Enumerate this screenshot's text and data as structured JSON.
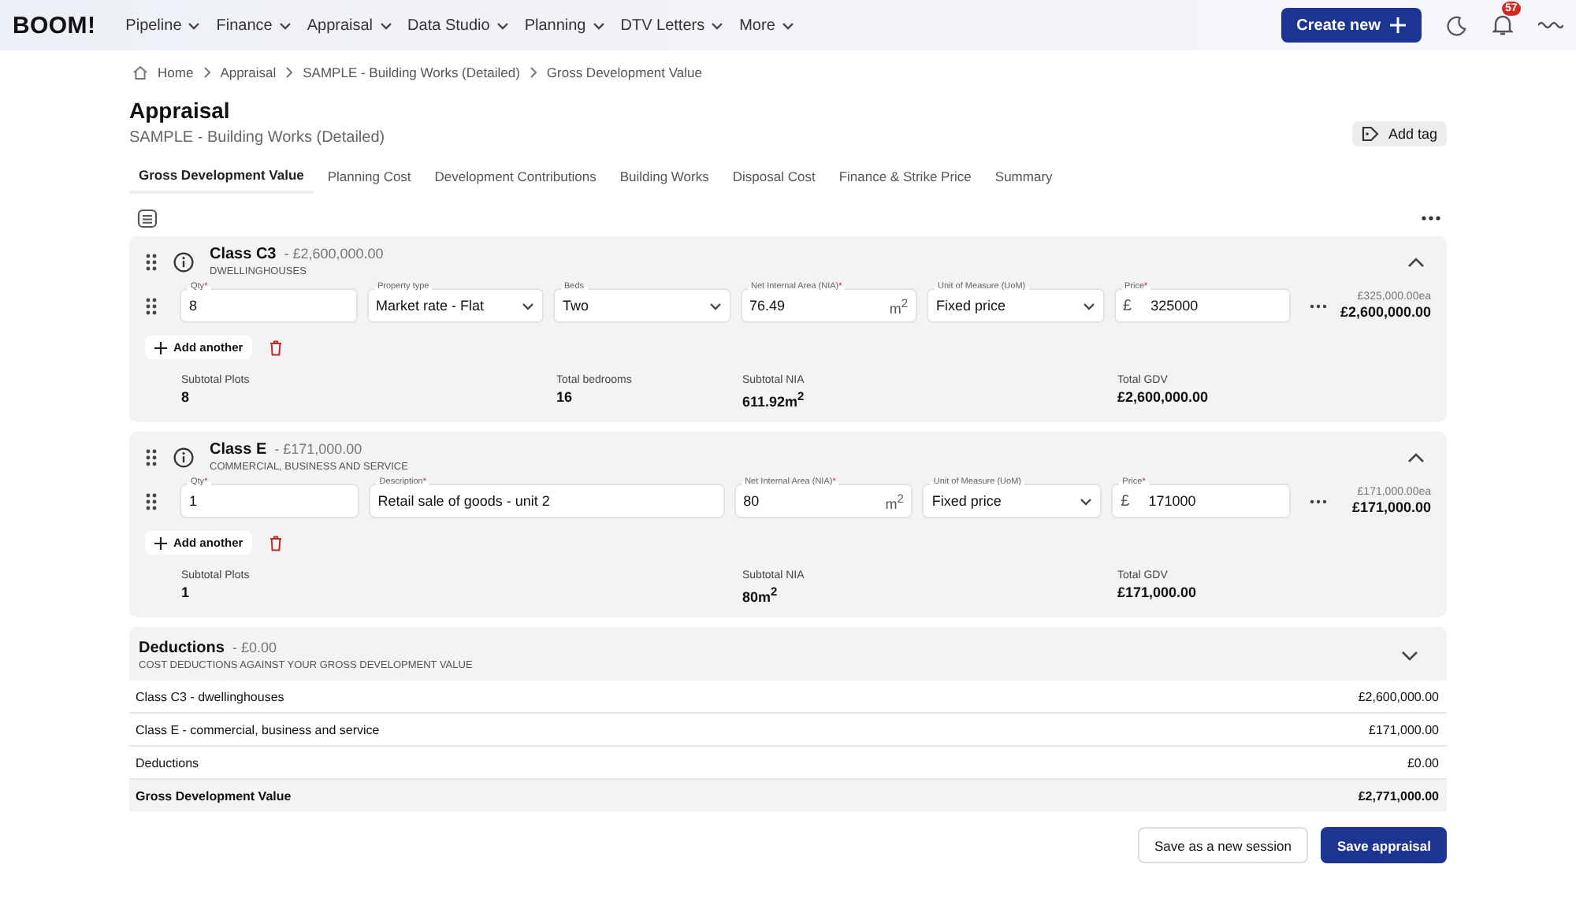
{
  "nav": {
    "logo": "BOOM!",
    "items": [
      "Pipeline",
      "Finance",
      "Appraisal",
      "Data Studio",
      "Planning",
      "DTV Letters",
      "More"
    ],
    "create_button": "Create new",
    "notification_count": "57"
  },
  "breadcrumbs": [
    "Home",
    "Appraisal",
    "SAMPLE - Building Works (Detailed)",
    "Gross Development Value"
  ],
  "page": {
    "title": "Appraisal",
    "subtitle": "SAMPLE - Building Works (Detailed)",
    "add_tag": "Add tag"
  },
  "tabs": [
    {
      "label": "Gross Development Value",
      "selected": true
    },
    {
      "label": "Planning Cost",
      "selected": false
    },
    {
      "label": "Development Contributions",
      "selected": false
    },
    {
      "label": "Building Works",
      "selected": false
    },
    {
      "label": "Disposal Cost",
      "selected": false
    },
    {
      "label": "Finance & Strike Price",
      "selected": false
    },
    {
      "label": "Summary",
      "selected": false
    }
  ],
  "sections": [
    {
      "title": "Class C3",
      "amount": "- £2,600,000.00",
      "subtitle": "DWELLINGHOUSES",
      "expanded": true,
      "rows": [
        {
          "fields": [
            {
              "kind": "text",
              "label": "Qty",
              "required_mark": "*",
              "value": "8"
            },
            {
              "kind": "select",
              "label": "Property type",
              "value": "Market rate - Flat"
            },
            {
              "kind": "select",
              "label": "Beds",
              "value": "Two"
            },
            {
              "kind": "area",
              "label": "Net Internal Area (NIA)",
              "required_mark": "*",
              "value": "76.49",
              "unit": "m$^{2}$"
            },
            {
              "kind": "select",
              "label": "Unit of Measure (UoM)",
              "value": "Fixed price"
            },
            {
              "kind": "price",
              "label": "Price",
              "required_mark": "*",
              "prefix": "£",
              "value": "325000"
            }
          ],
          "each": "£325,000.00ea",
          "total": "£2,600,000.00"
        }
      ],
      "add_another": "Add another",
      "stats": [
        {
          "kind": "plots",
          "label": "Subtotal Plots",
          "value": "8"
        },
        {
          "kind": "bedrooms",
          "label": "Total bedrooms",
          "value": "16"
        },
        {
          "kind": "nia",
          "label": "Subtotal NIA",
          "value": "611.92m$^{2}$"
        },
        {
          "kind": "gdv",
          "label": "Total GDV",
          "value": "£2,600,000.00"
        }
      ]
    },
    {
      "title": "Class E",
      "amount": "- £171,000.00",
      "subtitle": "COMMERCIAL, BUSINESS AND SERVICE",
      "expanded": true,
      "rows": [
        {
          "fields": [
            {
              "kind": "text",
              "label": "Qty",
              "required_mark": "*",
              "value": "1"
            },
            {
              "kind": "wide",
              "label": "Description",
              "required_mark": "*",
              "value": "Retail sale of goods - unit 2"
            },
            {
              "kind": "area",
              "label": "Net Internal Area (NIA)",
              "required_mark": "*",
              "value": "80",
              "unit": "m$^{2}$"
            },
            {
              "kind": "select",
              "label": "Unit of Measure (UoM)",
              "value": "Fixed price"
            },
            {
              "kind": "price",
              "label": "Price",
              "required_mark": "*",
              "prefix": "£",
              "value": "171000"
            }
          ],
          "each": "£171,000.00ea",
          "total": "£171,000.00"
        }
      ],
      "add_another": "Add another",
      "stats": [
        {
          "kind": "plots",
          "label": "Subtotal Plots",
          "value": "1"
        },
        {
          "kind": "nia",
          "label": "Subtotal NIA",
          "value": "80m$^{2}$"
        },
        {
          "kind": "gdv",
          "label": "Total GDV",
          "value": "£171,000.00"
        }
      ]
    }
  ],
  "deductions": {
    "title": "Deductions",
    "amount": "- £0.00",
    "subtitle": "COST DEDUCTIONS AGAINST YOUR GROSS DEVELOPMENT VALUE",
    "expanded": false
  },
  "summary_rows": [
    {
      "label": "Class C3 - dwellinghouses",
      "value": "£2,600,000.00",
      "total": false
    },
    {
      "label": "Class E - commercial, business and service",
      "value": "£171,000.00",
      "total": false
    },
    {
      "label": "Deductions",
      "value": "£0.00",
      "total": false
    },
    {
      "label": "Gross Development Value",
      "value": "£2,771,000.00",
      "total": true
    }
  ],
  "actions": {
    "secondary": "Save as a new session",
    "primary": "Save appraisal"
  }
}
